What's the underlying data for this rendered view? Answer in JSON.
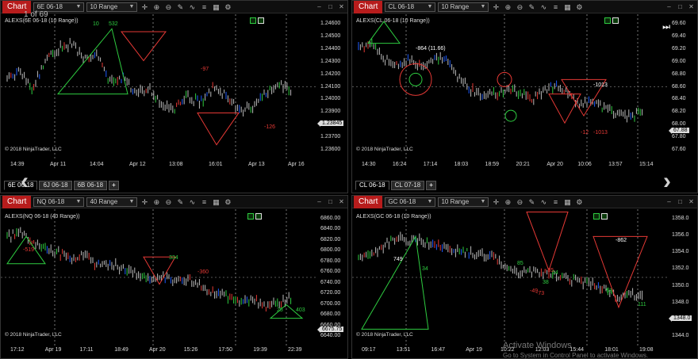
{
  "page_indicator": "1 of 69",
  "watermark": {
    "line1": "Activate Windows",
    "line2": "Go to System in Control Panel to activate Windows."
  },
  "panels": [
    {
      "id": "p1",
      "chart_label": "Chart",
      "instrument": "6E 06-18",
      "period": "10 Range",
      "chart_title": "ALEXS(6E 06-18 (10 Range))",
      "copyright": "© 2018 NinjaTrader, LLC",
      "y_labels": [
        "1.24600",
        "1.24500",
        "1.24400",
        "1.24300",
        "1.24200",
        "1.24100",
        "1.24000",
        "1.23900",
        "1.23800",
        "1.23700",
        "1.23600"
      ],
      "price_tag": "1.23845",
      "x_labels": [
        "14:39",
        "Apr 11",
        "14:04",
        "Apr 12",
        "13:08",
        "16:01",
        "Apr 13",
        "Apr 16"
      ],
      "tabs": [
        "6E 06-18",
        "6J 06-18",
        "6B 06-18",
        "+"
      ],
      "annotations": [
        {
          "text": "10",
          "color": "green"
        },
        {
          "text": "532",
          "color": "green"
        },
        {
          "text": "-97",
          "color": "red"
        },
        {
          "text": "-126",
          "color": "red"
        }
      ]
    },
    {
      "id": "p2",
      "chart_label": "Chart",
      "instrument": "CL 06-18",
      "period": "10 Range",
      "chart_title": "ALEXS(CL 06-18 (10 Range))",
      "copyright": "© 2018 NinjaTrader, LLC",
      "y_labels": [
        "69.60",
        "69.40",
        "69.20",
        "69.00",
        "68.80",
        "68.60",
        "68.40",
        "68.20",
        "68.00",
        "67.80",
        "67.60"
      ],
      "price_tag": "67.88",
      "x_labels": [
        "14:30",
        "16:24",
        "17:14",
        "18:03",
        "18:59",
        "20:21",
        "Apr 20",
        "10:06",
        "13:57",
        "15:14"
      ],
      "tabs": [
        "CL 06-18",
        "CL 07-18",
        "+"
      ],
      "annotations": [
        {
          "text": "-864 (11.66)",
          "color": "white"
        },
        {
          "text": "-1013",
          "color": "white"
        },
        {
          "text": "-12",
          "color": "red"
        },
        {
          "text": "-1013",
          "color": "red"
        }
      ]
    },
    {
      "id": "p3",
      "chart_label": "Chart",
      "instrument": "NQ 06-18",
      "period": "40 Range",
      "chart_title": "ALEXS(NQ 06-18 (40 Range))",
      "copyright": "© 2018 NinjaTrader, LLC",
      "y_labels": [
        "6860.00",
        "6840.00",
        "6820.00",
        "6800.00",
        "6780.00",
        "6760.00",
        "6740.00",
        "6720.00",
        "6700.00",
        "6680.00",
        "6660.00",
        "6640.00"
      ],
      "price_tag": "6675.75",
      "x_labels": [
        "17:12",
        "Apr 19",
        "17:11",
        "18:49",
        "Apr 20",
        "15:26",
        "17:50",
        "19:39",
        "22:39"
      ],
      "annotations": [
        {
          "text": "-519",
          "color": "red"
        },
        {
          "text": "334",
          "color": "green"
        },
        {
          "text": "-360",
          "color": "red"
        },
        {
          "text": "25",
          "color": "green"
        },
        {
          "text": "403",
          "color": "green"
        }
      ]
    },
    {
      "id": "p4",
      "chart_label": "Chart",
      "instrument": "GC 06-18",
      "period": "10 Range",
      "chart_title": "ALEXS(GC 06-18 (10 Range))",
      "copyright": "© 2018 NinjaTrader, LLC",
      "y_labels": [
        "1358.0",
        "1356.0",
        "1354.0",
        "1352.0",
        "1350.0",
        "1348.0",
        "1346.0",
        "1344.0"
      ],
      "price_tag": "1348.0",
      "x_labels": [
        "09:17",
        "13:51",
        "16:47",
        "Apr 19",
        "10:22",
        "12:03",
        "15:44",
        "18:01",
        "19:08"
      ],
      "annotations": [
        {
          "text": "749",
          "color": "white"
        },
        {
          "text": "-862",
          "color": "white"
        },
        {
          "text": "34",
          "color": "green"
        },
        {
          "text": "85",
          "color": "green"
        },
        {
          "text": "38",
          "color": "green"
        },
        {
          "text": "54",
          "color": "green"
        },
        {
          "text": "53",
          "color": "green"
        },
        {
          "text": "111",
          "color": "green"
        },
        {
          "text": "-49",
          "color": "red"
        },
        {
          "text": "-35",
          "color": "red"
        },
        {
          "text": "-73",
          "color": "red"
        }
      ]
    }
  ]
}
